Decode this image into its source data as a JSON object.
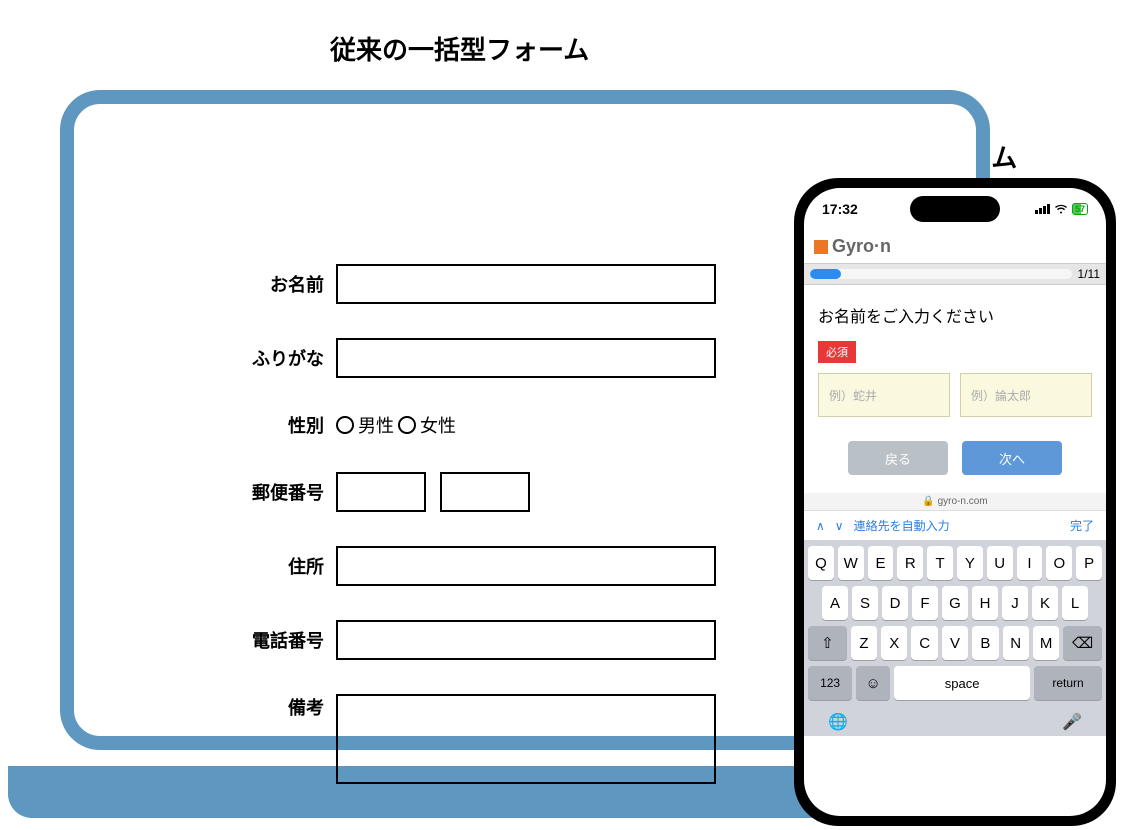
{
  "titles": {
    "conventional": "従来の一括型フォーム",
    "step": "ステップフォーム"
  },
  "conv_form": {
    "name": "お名前",
    "furigana": "ふりがな",
    "gender": "性別",
    "gender_m": "男性",
    "gender_f": "女性",
    "postal": "郵便番号",
    "address": "住所",
    "phone": "電話番号",
    "remarks": "備考"
  },
  "phone": {
    "time": "17:32",
    "battery": "57",
    "brand": "Gyro·n",
    "progress": "1/11",
    "prompt": "お名前をご入力ください",
    "required": "必須",
    "ph_last": "例）蛇井",
    "ph_first": "例）論太郎",
    "btn_back": "戻る",
    "btn_next": "次へ",
    "url": "gyro-n.com",
    "kb_autofill": "連絡先を自動入力",
    "kb_done": "完了",
    "row1": [
      "Q",
      "W",
      "E",
      "R",
      "T",
      "Y",
      "U",
      "I",
      "O",
      "P"
    ],
    "row2": [
      "A",
      "S",
      "D",
      "F",
      "G",
      "H",
      "J",
      "K",
      "L"
    ],
    "row3": [
      "Z",
      "X",
      "C",
      "V",
      "B",
      "N",
      "M"
    ],
    "key_123": "123",
    "key_space": "space",
    "key_return": "return"
  }
}
